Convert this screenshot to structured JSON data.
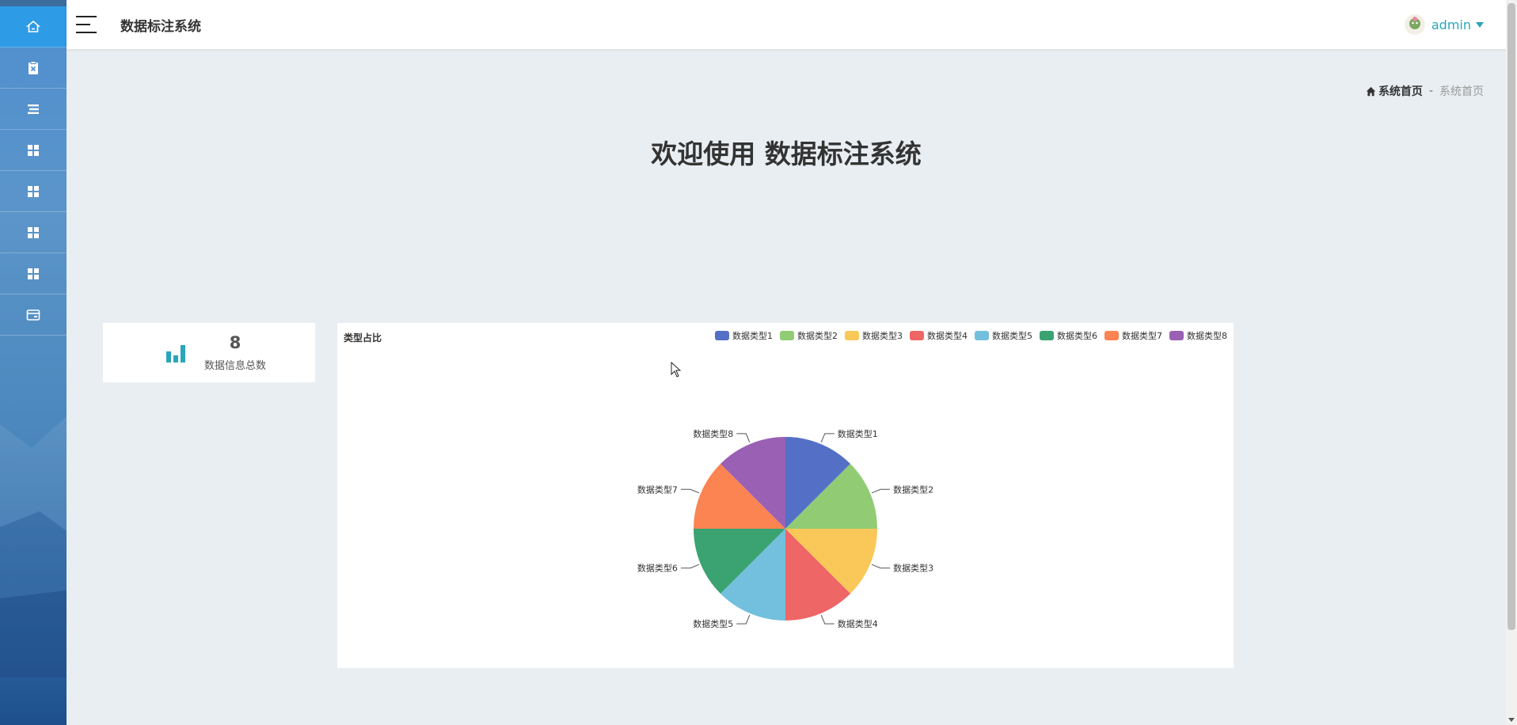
{
  "app": {
    "title": "数据标注系统"
  },
  "sidebar": {
    "items": [
      {
        "icon": "home-icon",
        "active": true
      },
      {
        "icon": "clipboard-icon"
      },
      {
        "icon": "list-icon"
      },
      {
        "icon": "grid-icon"
      },
      {
        "icon": "grid-icon"
      },
      {
        "icon": "grid-icon"
      },
      {
        "icon": "grid-icon"
      },
      {
        "icon": "wallet-icon"
      }
    ]
  },
  "user": {
    "name": "admin"
  },
  "breadcrumb": {
    "home": "系统首页",
    "separator": "-",
    "current": "系统首页"
  },
  "welcome": "欢迎使用 数据标注系统",
  "stat": {
    "value": "8",
    "label": "数据信息总数",
    "icon_color": "#2aa5b9"
  },
  "chart_data": {
    "type": "pie",
    "title": "类型占比",
    "categories": [
      "数据类型1",
      "数据类型2",
      "数据类型3",
      "数据类型4",
      "数据类型5",
      "数据类型6",
      "数据类型7",
      "数据类型8"
    ],
    "values": [
      1,
      1,
      1,
      1,
      1,
      1,
      1,
      1
    ],
    "colors": [
      "#5470c6",
      "#91cc75",
      "#fac858",
      "#ee6666",
      "#73c0de",
      "#3ba272",
      "#fc8452",
      "#9a60b4"
    ],
    "legend_position": "top-right"
  }
}
